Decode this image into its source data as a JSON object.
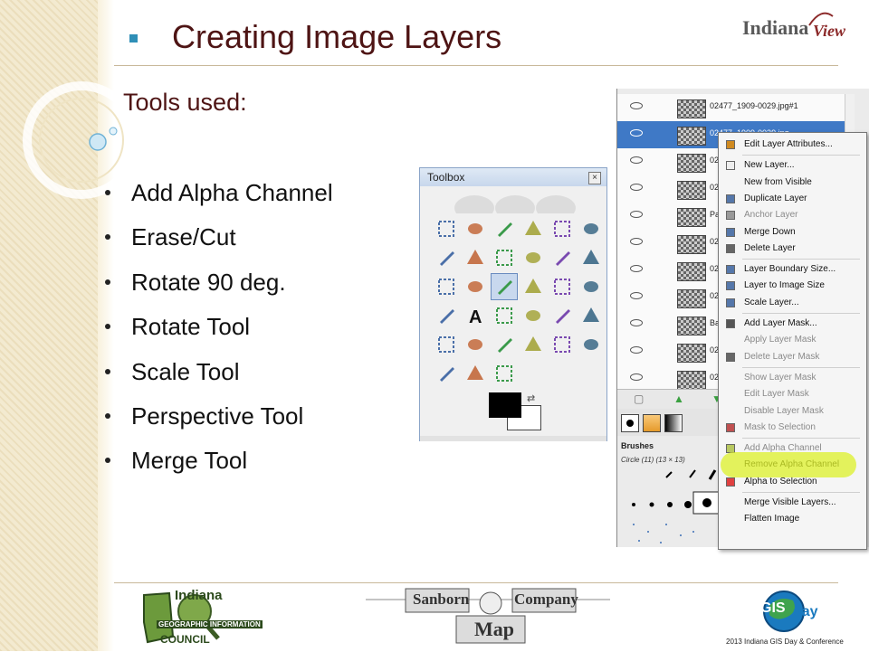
{
  "slide": {
    "title": "Creating Image Layers",
    "subtitle": "Tools used:",
    "tools": [
      "Add Alpha Channel",
      "Erase/Cut",
      "Rotate 90 deg.",
      "Rotate Tool",
      "Scale Tool",
      "Perspective Tool",
      "Merge Tool"
    ]
  },
  "header_logo": {
    "text": "Indiana",
    "text2": "View"
  },
  "toolbox": {
    "title": "Toolbox",
    "close_glyph": "×",
    "tools": [
      "rect-select",
      "ellipse-select",
      "free-select",
      "fuzzy-select",
      "select-by-color",
      "scissors-select",
      "foreground-select",
      "paths",
      "color-picker",
      "zoom",
      "measure",
      "move",
      "align",
      "crop",
      "rotate",
      "scale",
      "shear",
      "perspective",
      "flip",
      "text",
      "bucket-fill",
      "blend",
      "pencil",
      "paintbrush",
      "eraser",
      "airbrush",
      "ink",
      "clone",
      "heal",
      "perspective-clone",
      "blur",
      "smudge",
      "dodge-burn"
    ],
    "selected_tool": "rotate"
  },
  "layers": [
    {
      "name": "02477_1909-0029.jpg#1",
      "selected": false
    },
    {
      "name": "02477_1909-0039.jpg",
      "selected": true
    },
    {
      "name": "024",
      "selected": false
    },
    {
      "name": "024",
      "selected": false
    },
    {
      "name": "Past",
      "selected": false
    },
    {
      "name": "024",
      "selected": false
    },
    {
      "name": "024",
      "selected": false
    },
    {
      "name": "024",
      "selected": false
    },
    {
      "name": "Bac",
      "selected": false
    },
    {
      "name": "024",
      "selected": false
    },
    {
      "name": "024",
      "selected": false
    }
  ],
  "brushes": {
    "label": "Brushes",
    "sub": "Circle (11) (13 × 13)"
  },
  "context_menu": [
    {
      "label": "Edit Layer Attributes...",
      "disabled": false,
      "icon": "edit"
    },
    {
      "sep": true
    },
    {
      "label": "New Layer...",
      "disabled": false,
      "icon": "new"
    },
    {
      "label": "New from Visible",
      "disabled": false,
      "icon": ""
    },
    {
      "label": "Duplicate Layer",
      "disabled": false,
      "icon": "dup"
    },
    {
      "label": "Anchor Layer",
      "disabled": true,
      "icon": "anchor"
    },
    {
      "label": "Merge Down",
      "disabled": false,
      "icon": "merge"
    },
    {
      "label": "Delete Layer",
      "disabled": false,
      "icon": "delete"
    },
    {
      "sep": true
    },
    {
      "label": "Layer Boundary Size...",
      "disabled": false,
      "icon": "bound"
    },
    {
      "label": "Layer to Image Size",
      "disabled": false,
      "icon": "tosize"
    },
    {
      "label": "Scale Layer...",
      "disabled": false,
      "icon": "scale"
    },
    {
      "sep": true
    },
    {
      "label": "Add Layer Mask...",
      "disabled": false,
      "icon": "mask"
    },
    {
      "label": "Apply Layer Mask",
      "disabled": true,
      "icon": ""
    },
    {
      "label": "Delete Layer Mask",
      "disabled": true,
      "icon": "delete"
    },
    {
      "sep": true
    },
    {
      "label": "Show Layer Mask",
      "disabled": true,
      "icon": ""
    },
    {
      "label": "Edit Layer Mask",
      "disabled": true,
      "icon": ""
    },
    {
      "label": "Disable Layer Mask",
      "disabled": true,
      "icon": ""
    },
    {
      "label": "Mask to Selection",
      "disabled": true,
      "icon": "masksel"
    },
    {
      "sep": true
    },
    {
      "label": "Add Alpha Channel",
      "disabled": true,
      "icon": "alpha"
    },
    {
      "label": "Remove Alpha Channel",
      "disabled": false,
      "icon": ""
    },
    {
      "label": "Alpha to Selection",
      "disabled": false,
      "icon": "alphasel"
    },
    {
      "sep": true
    },
    {
      "label": "Merge Visible Layers...",
      "disabled": false,
      "icon": ""
    },
    {
      "label": "Flatten Image",
      "disabled": false,
      "icon": ""
    }
  ],
  "footer": {
    "left_logo": [
      "Indiana",
      "GEOGRAPHIC INFORMATION",
      "COUNCIL"
    ],
    "mid_logo": [
      "Sanborn",
      "Company",
      "Map"
    ],
    "right_logo": [
      "GIS",
      "day"
    ],
    "conference": "2013 Indiana GIS Day & Conference"
  },
  "colors": {
    "title": "#4e1414",
    "accent_bullet": "#2f8fb7",
    "selection": "#3f79c6",
    "highlight": "#dcf028"
  }
}
